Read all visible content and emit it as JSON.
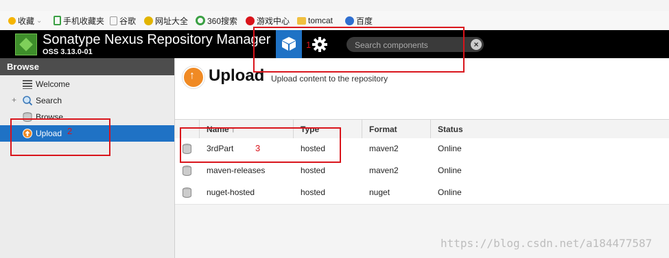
{
  "browser": {
    "bookmarks": [
      {
        "label": "收藏",
        "icon": "star-icon",
        "color": "#f5b400"
      },
      {
        "label": "手机收藏夹",
        "icon": "phone-icon",
        "color": "#3aa043"
      },
      {
        "label": "谷歌",
        "icon": "page-icon",
        "color": "#999999"
      },
      {
        "label": "网址大全",
        "icon": "nav-globe-icon",
        "color": "#e2b400"
      },
      {
        "label": "360搜索",
        "icon": "circle-icon",
        "color": "#3aa043"
      },
      {
        "label": "游戏中心",
        "icon": "game-icon",
        "color": "#d9141b"
      },
      {
        "label": "tomcat",
        "icon": "folder-icon",
        "color": "#f0c040"
      },
      {
        "label": "百度",
        "icon": "paw-icon",
        "color": "#2f6fd0"
      }
    ]
  },
  "header": {
    "title": "Sonatype Nexus Repository Manager",
    "version": "OSS 3.13.0-01",
    "browse_mode_icon": "cube-icon",
    "admin_icon": "gear-icon",
    "search_placeholder": "Search components",
    "search_clear_icon": "close-icon",
    "accent": "#1f72c5"
  },
  "sidebar": {
    "heading": "Browse",
    "items": [
      {
        "label": "Welcome",
        "icon": "list-icon"
      },
      {
        "label": "Search",
        "icon": "magnifier-icon",
        "expander": "+"
      },
      {
        "label": "Browse",
        "icon": "database-icon"
      },
      {
        "label": "Upload",
        "icon": "upload-icon",
        "selected": true
      }
    ]
  },
  "main": {
    "title": "Upload",
    "subtitle": "Upload content to the repository",
    "columns": [
      "Name ↑",
      "Type",
      "Format",
      "Status"
    ],
    "rows": [
      {
        "name": "3rdPart",
        "type": "hosted",
        "format": "maven2",
        "status": "Online"
      },
      {
        "name": "maven-releases",
        "type": "hosted",
        "format": "maven2",
        "status": "Online"
      },
      {
        "name": "nuget-hosted",
        "type": "hosted",
        "format": "nuget",
        "status": "Online"
      }
    ]
  },
  "annotations": {
    "n1": "1",
    "n2": "2",
    "n3": "3",
    "color": "#d9141b"
  },
  "watermark": "https://blog.csdn.net/a184477587"
}
